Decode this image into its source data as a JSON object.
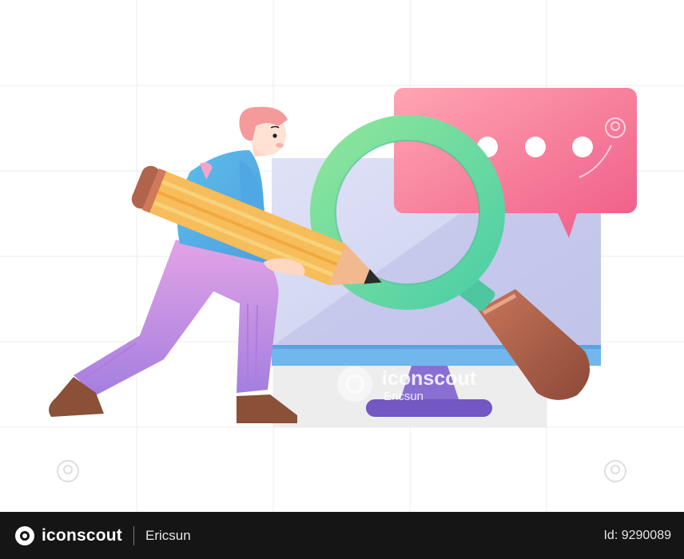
{
  "watermark": {
    "brand": "iconscout",
    "author": "Ericsun"
  },
  "footer": {
    "brand": "iconscout",
    "author": "Ericsun",
    "asset_id": "Id: 9290089"
  },
  "colors": {
    "footer_bg": "#151515",
    "bubble_pink": "#f57f99",
    "magnifier_green": "#5fd6a0",
    "handle_brown": "#b0624a",
    "monitor_screen": "#d6d9f1",
    "monitor_bezel": "#6fb7ec",
    "stand_purple": "#7a5fc6",
    "pencil_yellow": "#f6bd5a",
    "shirt_blue": "#55b6e9",
    "pants_violet": "#c48ce6",
    "hair_pink": "#f49a9a"
  },
  "icons": [
    "iconscout-logo-icon",
    "search-watermark-icon",
    "speech-bubble-dots",
    "magnifying-glass",
    "pencil",
    "monitor"
  ]
}
